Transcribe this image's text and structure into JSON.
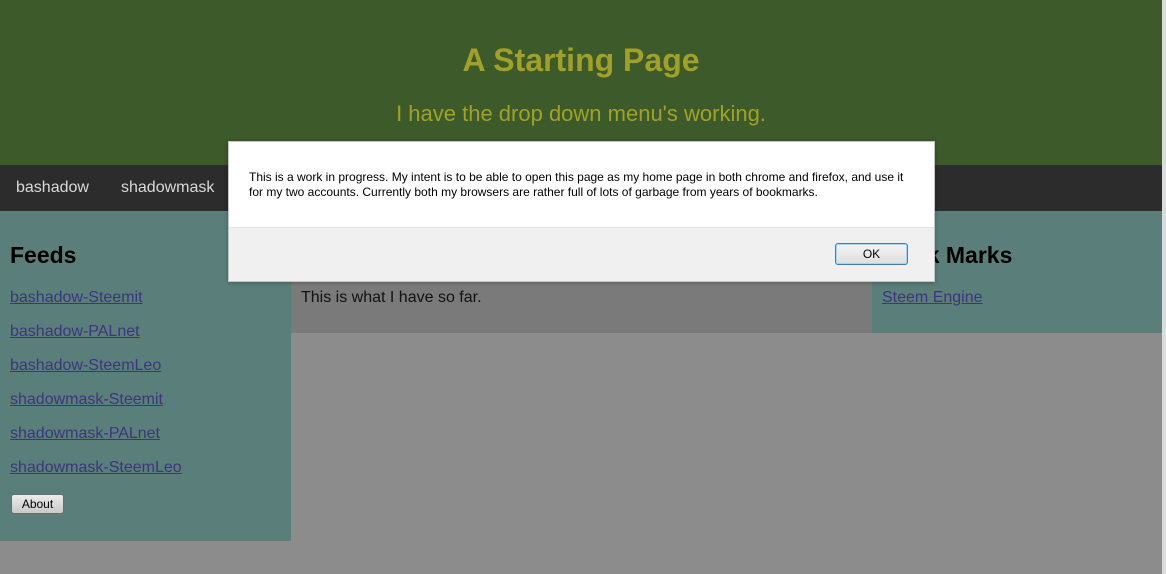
{
  "header": {
    "title": "A Starting Page",
    "subtitle": "I have the drop down menu's working."
  },
  "nav": {
    "items": [
      "bashadow",
      "shadowmask"
    ]
  },
  "left": {
    "heading": "Feeds",
    "links": [
      "bashadow-Steemit",
      "bashadow-PALnet",
      "bashadow-SteemLeo",
      "shadowmask-Steemit",
      "shadowmask-PALnet",
      "shadowmask-SteemLeo"
    ],
    "about_label": "About"
  },
  "middle": {
    "text": "This is what I have so far."
  },
  "right": {
    "heading": "Book Marks",
    "links": [
      "Steem Engine"
    ]
  },
  "dialog": {
    "message": "This is a work in progress. My intent is to be able to open this page as my home page in both chrome and firefox, and use it for my two accounts. Currently both my browsers are rather full of lots of garbage from years of bookmarks.",
    "ok_label": "OK"
  },
  "colors": {
    "header_bg": "#3d5a2a",
    "title_color": "#a1a128",
    "nav_bg": "#2c2c2c",
    "side_bg": "#5a7e79",
    "link_color": "#3d3580"
  }
}
